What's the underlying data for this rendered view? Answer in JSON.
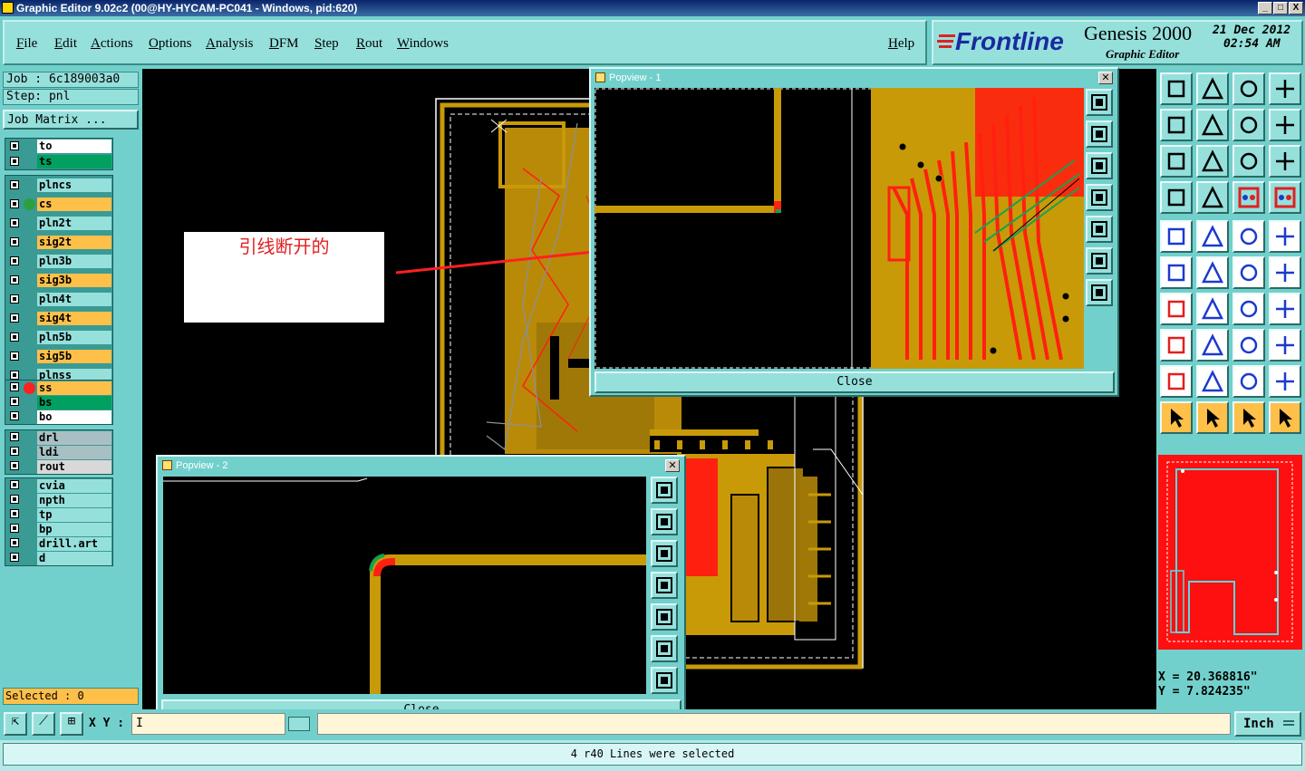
{
  "window": {
    "title": "Graphic Editor 9.02c2 (00@HY-HYCAM-PC041 - Windows, pid:620)",
    "controls": [
      "_",
      "□",
      "X"
    ]
  },
  "menu": [
    "File",
    "Edit",
    "Actions",
    "Options",
    "Analysis",
    "DFM",
    "Step",
    "Rout",
    "Windows"
  ],
  "help_label": "Help",
  "brand": {
    "logo": "Frontline",
    "product": "Genesis 2000",
    "subtitle": "Graphic Editor",
    "date": "21 Dec 2012",
    "time": "02:54 AM"
  },
  "job": {
    "job_label": "Job : 6c189003a0",
    "step_label": "Step: pnl",
    "matrix_button": "Job Matrix ..."
  },
  "layers": [
    {
      "name": "to",
      "color": "#ffffff",
      "dot": null
    },
    {
      "name": "ts",
      "color": "#00a060",
      "dot": null
    },
    {
      "name": "plncs",
      "color": "#96e0dc",
      "dot": null
    },
    {
      "name": "cs",
      "color": "#ffc04a",
      "dot": "#2aa040"
    },
    {
      "name": "pln2t",
      "color": "#96e0dc",
      "dot": null
    },
    {
      "name": "sig2t",
      "color": "#ffc04a",
      "dot": null
    },
    {
      "name": "pln3b",
      "color": "#96e0dc",
      "dot": null
    },
    {
      "name": "sig3b",
      "color": "#ffc04a",
      "dot": null
    },
    {
      "name": "pln4t",
      "color": "#96e0dc",
      "dot": null
    },
    {
      "name": "sig4t",
      "color": "#ffc04a",
      "dot": null
    },
    {
      "name": "pln5b",
      "color": "#96e0dc",
      "dot": null
    },
    {
      "name": "sig5b",
      "color": "#ffc04a",
      "dot": null
    },
    {
      "name": "plnss",
      "color": "#96e0dc",
      "dot": null
    },
    {
      "name": "ss",
      "color": "#ffc04a",
      "dot": "#ff2020"
    },
    {
      "name": "bs",
      "color": "#00a060",
      "dot": null
    },
    {
      "name": "bo",
      "color": "#ffffff",
      "dot": null
    },
    {
      "name": "drl",
      "color": "#a8c0c4",
      "dot": null
    },
    {
      "name": "ldi",
      "color": "#a8c0c4",
      "dot": null
    },
    {
      "name": "rout",
      "color": "#d8d8d8",
      "dot": null
    },
    {
      "name": "cvia",
      "color": "#96e0dc",
      "dot": null
    },
    {
      "name": "npth",
      "color": "#96e0dc",
      "dot": null
    },
    {
      "name": "tp",
      "color": "#96e0dc",
      "dot": null
    },
    {
      "name": "bp",
      "color": "#96e0dc",
      "dot": null
    },
    {
      "name": "drill.art",
      "color": "#96e0dc",
      "dot": null
    },
    {
      "name": "d",
      "color": "#96e0dc",
      "dot": null
    }
  ],
  "selected_label": "Selected : 0",
  "annotation_text": "引线断开的",
  "popview1": {
    "title": "Popview - 1",
    "close_label": "Close"
  },
  "popview2": {
    "title": "Popview - 2",
    "close_label": "Close"
  },
  "coords": {
    "x": "X = 20.368816\"",
    "y": "Y = 7.824235\""
  },
  "xy_label": "X Y :",
  "xy_value": "I",
  "units": "Inch",
  "status_message": "4 r40 Lines were selected",
  "colors": {
    "panel": "#72d0cc",
    "panel_light": "#96e0dc",
    "copper": "#c89a08",
    "trace_red": "#ff2010",
    "highlight_green": "#1aa050"
  }
}
